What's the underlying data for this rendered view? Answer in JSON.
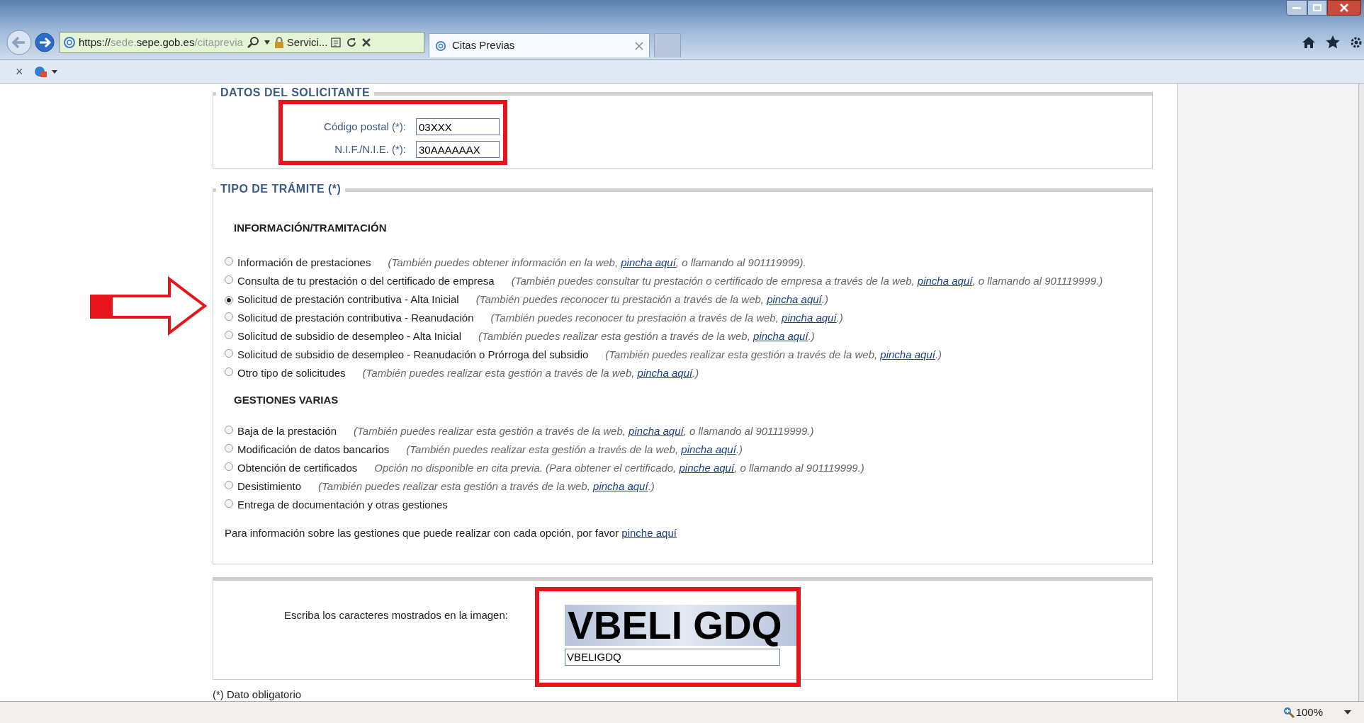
{
  "browser": {
    "url": {
      "scheme": "https://",
      "host_prefix": "sede.",
      "domain": "sepe.gob.es",
      "path": "/citaprevia"
    },
    "site_label": "Servici...",
    "tabs": [
      {
        "label": "Citas Previas",
        "selected": true
      }
    ],
    "command_close": "×",
    "zoom": "100%"
  },
  "datos": {
    "legend": "DATOS DEL SOLICITANTE",
    "fields": [
      {
        "label": "Código postal (*):",
        "value": "03XXX"
      },
      {
        "label": "N.I.F./N.I.E. (*):",
        "value": "30AAAAAAX"
      }
    ]
  },
  "tramite": {
    "legend": "TIPO DE TRÁMITE (*)",
    "groups": [
      {
        "heading": "INFORMACIÓN/TRAMITACIÓN",
        "options": [
          {
            "label": "Información de prestaciones",
            "note": "(También puedes obtener información en la web, ",
            "link": "pincha aquí",
            "note_end": ", o llamando al 901119999).",
            "selected": false
          },
          {
            "label": "Consulta de tu prestación o del certificado de empresa",
            "note": "(También puedes consultar tu prestación o certificado de empresa a través de la web, ",
            "link": "pincha aquí",
            "note_end": ", o llamando al 901119999.)",
            "selected": false
          },
          {
            "label": "Solicitud de prestación contributiva - Alta Inicial",
            "note": "(También puedes reconocer tu prestación a través de la web, ",
            "link": "pincha aquí",
            "note_end": ".)",
            "selected": true
          },
          {
            "label": "Solicitud de prestación contributiva - Reanudación",
            "note": "(También puedes reconocer tu prestación a través de la web, ",
            "link": "pincha aquí",
            "note_end": ".)",
            "selected": false
          },
          {
            "label": "Solicitud de subsidio de desempleo - Alta Inicial",
            "note": "(También puedes realizar esta gestión a través de la web, ",
            "link": "pincha aquí",
            "note_end": ".)",
            "selected": false
          },
          {
            "label": "Solicitud de subsidio de desempleo - Reanudación o Prórroga del subsidio",
            "note": "(También puedes realizar esta gestión a través de la web, ",
            "link": "pincha aquí",
            "note_end": ".)",
            "selected": false
          },
          {
            "label": "Otro tipo de solicitudes",
            "note": "(También puedes realizar esta gestión a través de la web, ",
            "link": "pincha aquí",
            "note_end": ".)",
            "selected": false
          }
        ]
      },
      {
        "heading": "GESTIONES VARIAS",
        "options": [
          {
            "label": "Baja de la prestación",
            "note": "(También puedes realizar esta gestión a través de la web, ",
            "link": "pincha aquí",
            "note_end": ", o llamando al 901119999.)",
            "selected": false
          },
          {
            "label": "Modificación de datos bancarios",
            "note": "(También puedes realizar esta gestión a través de la web, ",
            "link": "pincha aquí",
            "note_end": ".)",
            "selected": false
          },
          {
            "label": "Obtención de certificados",
            "note": "Opción no disponible en cita previa. (Para obtener el certificado, ",
            "link": "pinche aquí",
            "note_end": ", o llamando al 901119999.)",
            "selected": false
          },
          {
            "label": "Desistimiento",
            "note": "(También puedes realizar esta gestión a través de la web, ",
            "link": "pincha aquí",
            "note_end": ".)",
            "selected": false
          },
          {
            "label": "Entrega de documentación y otras gestiones",
            "selected": false
          }
        ]
      }
    ],
    "info": "Para información sobre las gestiones que puede realizar con cada opción, por favor ",
    "info_link": "pinche aquí"
  },
  "captcha": {
    "label": "Escriba los caracteres mostrados en la imagen:",
    "image_text": "VBELI GDQ",
    "value": "VBELIGDQ"
  },
  "footnote": "(*) Dato obligatorio"
}
